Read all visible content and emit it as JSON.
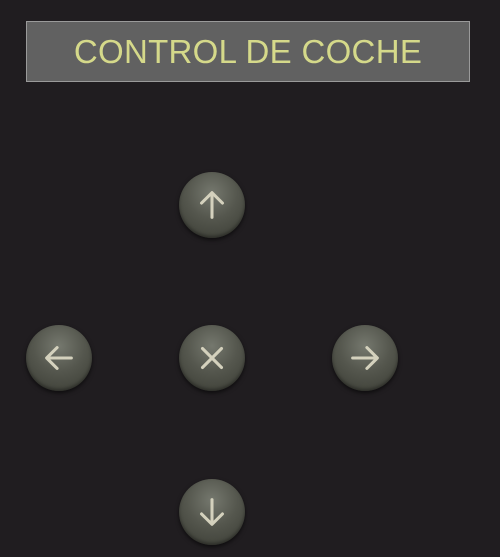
{
  "header": {
    "title": "CONTROL DE COCHE"
  },
  "controls": {
    "up": {
      "icon": "arrow-up-icon"
    },
    "left": {
      "icon": "arrow-left-icon"
    },
    "stop": {
      "icon": "close-icon"
    },
    "right": {
      "icon": "arrow-right-icon"
    },
    "down": {
      "icon": "arrow-down-icon"
    }
  },
  "colors": {
    "background": "#201d20",
    "title_bar": "#616161",
    "title_text": "#d5d98a",
    "button": "#55574e",
    "button_icon": "#d4d1bd"
  }
}
